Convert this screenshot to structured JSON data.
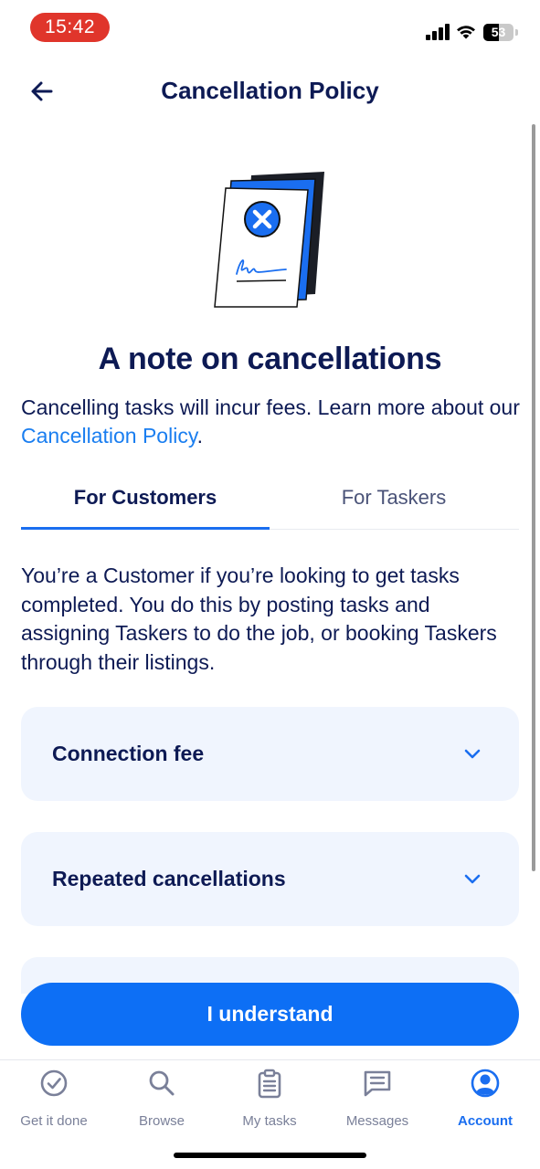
{
  "status_bar": {
    "time": "15:42",
    "battery": "53",
    "battery_level": 0.53
  },
  "header": {
    "title": "Cancellation Policy",
    "back_icon": "arrow-left-icon"
  },
  "hero": {
    "title": "A note on cancellations",
    "intro_text": "Cancelling tasks will incur fees. Learn more about our ",
    "intro_link": "Cancellation Policy",
    "intro_suffix": "."
  },
  "tabs": [
    {
      "label": "For Customers",
      "active": true
    },
    {
      "label": "For Taskers",
      "active": false
    }
  ],
  "description": "You’re a Customer if you’re looking to get tasks completed. You do this by posting tasks and assigning Taskers to do the job, or booking Taskers through their listings.",
  "accordions": [
    {
      "label": "Connection fee",
      "icon": "chevron-down-icon"
    },
    {
      "label": "Repeated cancellations",
      "icon": "chevron-down-icon"
    }
  ],
  "cta": {
    "label": "I understand"
  },
  "tabbar": {
    "items": [
      {
        "label": "Get it done",
        "icon": "check-circle-icon",
        "active": false
      },
      {
        "label": "Browse",
        "icon": "search-icon",
        "active": false
      },
      {
        "label": "My tasks",
        "icon": "clipboard-icon",
        "active": false
      },
      {
        "label": "Messages",
        "icon": "message-icon",
        "active": false
      },
      {
        "label": "Account",
        "icon": "account-icon",
        "active": true
      }
    ]
  },
  "colors": {
    "primary": "#0d6ff5",
    "heading": "#0d1a54",
    "link": "#1a7ef0",
    "card_bg": "#f0f5fe",
    "time_pill": "#e0352b"
  }
}
